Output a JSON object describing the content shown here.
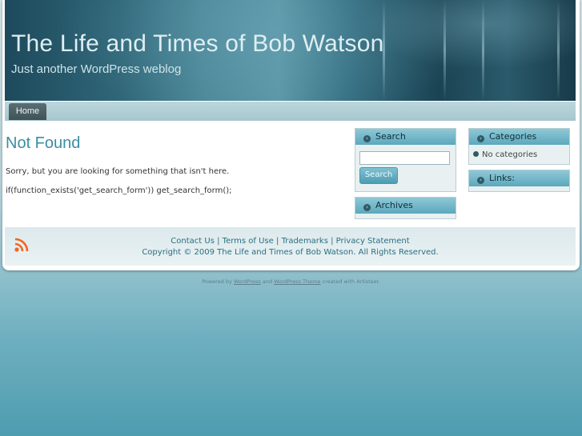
{
  "header": {
    "title": "The Life and Times of Bob Watson",
    "tagline": "Just another WordPress weblog"
  },
  "nav": {
    "home": "Home"
  },
  "main": {
    "title": "Not Found",
    "message": "Sorry, but you are looking for something that isn't here.",
    "code_text": "if(function_exists('get_search_form')) get_search_form();"
  },
  "sidebar": {
    "search": {
      "title": "Search",
      "input_value": "",
      "button": "Search"
    },
    "archives": {
      "title": "Archives"
    },
    "categories": {
      "title": "Categories",
      "empty": "No categories"
    },
    "links": {
      "title": "Links:"
    }
  },
  "footer": {
    "links": [
      "Contact Us",
      "Terms of Use",
      "Trademarks",
      "Privacy Statement"
    ],
    "separator": "|",
    "copyright": "Copyright © 2009 The Life and Times of Bob Watson. All Rights Reserved."
  },
  "credits": {
    "prefix": "Powered by",
    "wordpress": "WordPress",
    "and": "and",
    "theme": "WordPress Theme",
    "suffix": "created with Artisteer."
  },
  "colors": {
    "accent": "#3a8ea3",
    "header_dark": "#1d4a5c",
    "widget_head": "#5ca8bd",
    "rss": "#f26522"
  },
  "icons": [
    "rss-icon",
    "bullet-icon"
  ]
}
